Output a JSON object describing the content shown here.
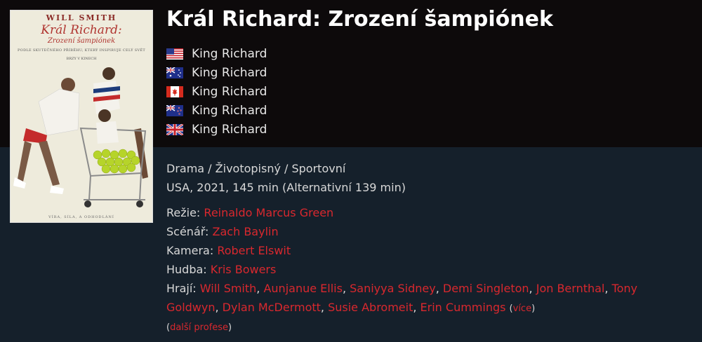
{
  "movie": {
    "title": "Král Richard: Zrození šampiónek",
    "poster": {
      "star": "WILL SMITH",
      "title": "Král Richard:",
      "subtitle": "Zrození šampiónek",
      "tagline": "PODLE SKUTEČNÉHO PŘÍBĚHU, KTERÝ INSPIRUJE CELÝ SVĚT",
      "release": "BRZY V KINECH",
      "bottom": "VÍRA, SÍLA, A ODHODLÁNÍ"
    },
    "aka": [
      {
        "country": "USA",
        "flag": "us-flag-icon",
        "name": "King Richard"
      },
      {
        "country": "Austrálie",
        "flag": "au-flag-icon",
        "name": "King Richard"
      },
      {
        "country": "Kanada",
        "flag": "ca-flag-icon",
        "name": "King Richard"
      },
      {
        "country": "Nový Zéland",
        "flag": "nz-flag-icon",
        "name": "King Richard"
      },
      {
        "country": "Velká Británie",
        "flag": "gb-flag-icon",
        "name": "King Richard"
      }
    ],
    "genres": "Drama / Životopisný / Sportovní",
    "origin": "USA, 2021, 145 min (Alternativní 139 min)",
    "crew": {
      "director_label": "Režie:",
      "director": "Reinaldo Marcus Green",
      "writer_label": "Scénář:",
      "writer": "Zach Baylin",
      "camera_label": "Kamera:",
      "camera": "Robert Elswit",
      "music_label": "Hudba:",
      "music": "Kris Bowers",
      "cast_label": "Hrají:",
      "cast": [
        "Will Smith",
        "Aunjanue Ellis",
        "Saniyya Sidney",
        "Demi Singleton",
        "Jon Bernthal",
        "Tony Goldwyn",
        "Dylan McDermott",
        "Susie Abromeit",
        "Erin Cummings"
      ],
      "more_cast": "více",
      "more_professions": "další profese"
    }
  },
  "colors": {
    "link": "#d9282e",
    "top_band": "#0d0a0b",
    "body_bg": "#15202b"
  }
}
